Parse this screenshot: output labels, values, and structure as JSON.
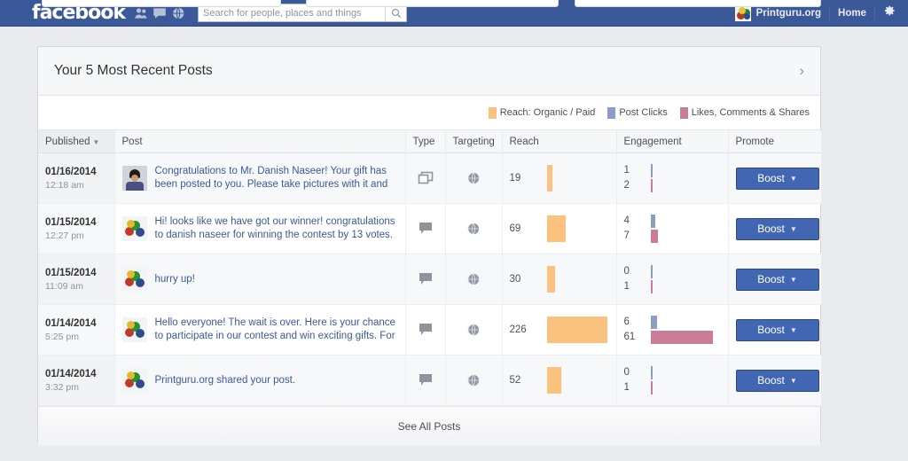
{
  "topbar": {
    "logo": "facebook",
    "icons": [
      "friends-icon",
      "messages-icon",
      "notifications-globe-icon"
    ],
    "search_placeholder": "Search for people, places and things",
    "search_value": "",
    "page_name": "Printguru.org",
    "home_label": "Home",
    "settings_icon": "gear-icon"
  },
  "card": {
    "title": "Your 5 Most Recent Posts",
    "expand_icon": "chevron-right-icon",
    "footer_label": "See All Posts"
  },
  "legend": [
    {
      "label": "Reach: Organic / Paid",
      "color": "#FBC27F"
    },
    {
      "label": "Post Clicks",
      "color": "#8B9DC3"
    },
    {
      "label": "Likes, Comments & Shares",
      "color": "#C97D99"
    }
  ],
  "columns": {
    "published": "Published",
    "post": "Post",
    "type": "Type",
    "targeting": "Targeting",
    "reach": "Reach",
    "engagement": "Engagement",
    "promote": "Promote"
  },
  "sort": {
    "column": "Published",
    "direction": "desc",
    "caret": "▼"
  },
  "boost_label": "Boost",
  "rows": [
    {
      "date": "01/16/2014",
      "time": "12:18 am",
      "text": "Congratulations to Mr. Danish Naseer! Your gift has been posted to you. Please take pictures with it and",
      "thumb": "person-photo-thumb",
      "type_icon": "photo-album-icon",
      "targeting_icon": "globe-icon",
      "reach": 19,
      "post_clicks": 1,
      "likes_comments_shares": 2
    },
    {
      "date": "01/15/2014",
      "time": "12:27 pm",
      "text": "Hi! looks like we have got our winner! congratulations to danish naseer for winning the contest by 13 votes.",
      "thumb": "page-logo-thumb",
      "type_icon": "status-comment-icon",
      "targeting_icon": "globe-icon",
      "reach": 69,
      "post_clicks": 4,
      "likes_comments_shares": 7
    },
    {
      "date": "01/15/2014",
      "time": "11:09 am",
      "text": "hurry up!",
      "thumb": "page-logo-thumb",
      "type_icon": "status-comment-icon",
      "targeting_icon": "globe-icon",
      "reach": 30,
      "post_clicks": 0,
      "likes_comments_shares": 1
    },
    {
      "date": "01/14/2014",
      "time": "5:25 pm",
      "text": "Hello everyone! The wait is over. Here is your chance to participate in our contest and win exciting gifts. For",
      "thumb": "page-logo-thumb",
      "type_icon": "status-comment-icon",
      "targeting_icon": "globe-icon",
      "reach": 226,
      "post_clicks": 6,
      "likes_comments_shares": 61
    },
    {
      "date": "01/14/2014",
      "time": "3:32 pm",
      "text": "Printguru.org shared your post.",
      "thumb": "page-logo-thumb",
      "type_icon": "status-comment-icon",
      "targeting_icon": "globe-icon",
      "reach": 52,
      "post_clicks": 0,
      "likes_comments_shares": 1
    }
  ],
  "chart_data": {
    "type": "bar",
    "title": "Your 5 Most Recent Posts",
    "categories": [
      "01/16/2014 12:18 am",
      "01/15/2014 12:27 pm",
      "01/15/2014 11:09 am",
      "01/14/2014 5:25 pm",
      "01/14/2014 3:32 pm"
    ],
    "series": [
      {
        "name": "Reach: Organic / Paid",
        "color": "#FBC27F",
        "values": [
          19,
          69,
          30,
          226,
          52
        ]
      },
      {
        "name": "Post Clicks",
        "color": "#8B9DC3",
        "values": [
          1,
          4,
          0,
          6,
          0
        ]
      },
      {
        "name": "Likes, Comments & Shares",
        "color": "#C97D99",
        "values": [
          2,
          7,
          1,
          61,
          1
        ]
      }
    ],
    "reach_max": 226,
    "engagement_max": 61,
    "xlabel": "",
    "ylabel": "",
    "legend_position": "top-right",
    "grid": false,
    "orientation": "horizontal"
  }
}
